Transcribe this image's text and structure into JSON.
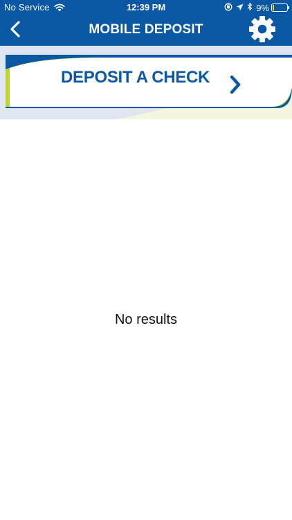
{
  "status_bar": {
    "carrier": "No Service",
    "time": "12:39 PM",
    "battery_percent": "9%",
    "battery_level": 0.09,
    "battery_color": "#f2d33c",
    "icons": [
      "wifi-icon",
      "orientation-lock-icon",
      "location-arrow-icon",
      "bluetooth-icon",
      "battery-icon"
    ]
  },
  "nav_bar": {
    "title": "MOBILE DEPOSIT",
    "back_icon": "chevron-left-icon",
    "settings_icon": "gear-icon",
    "background_color": "#0a58a3"
  },
  "banner": {
    "label": "DEPOSIT A CHECK",
    "chevron_icon": "chevron-right-icon",
    "accent_colors": {
      "blue": "#0a58a3",
      "lime": "#b9d72b",
      "light_blue": "#dfe6f1",
      "cream": "#f3f6dc"
    }
  },
  "content": {
    "empty_message": "No results"
  }
}
